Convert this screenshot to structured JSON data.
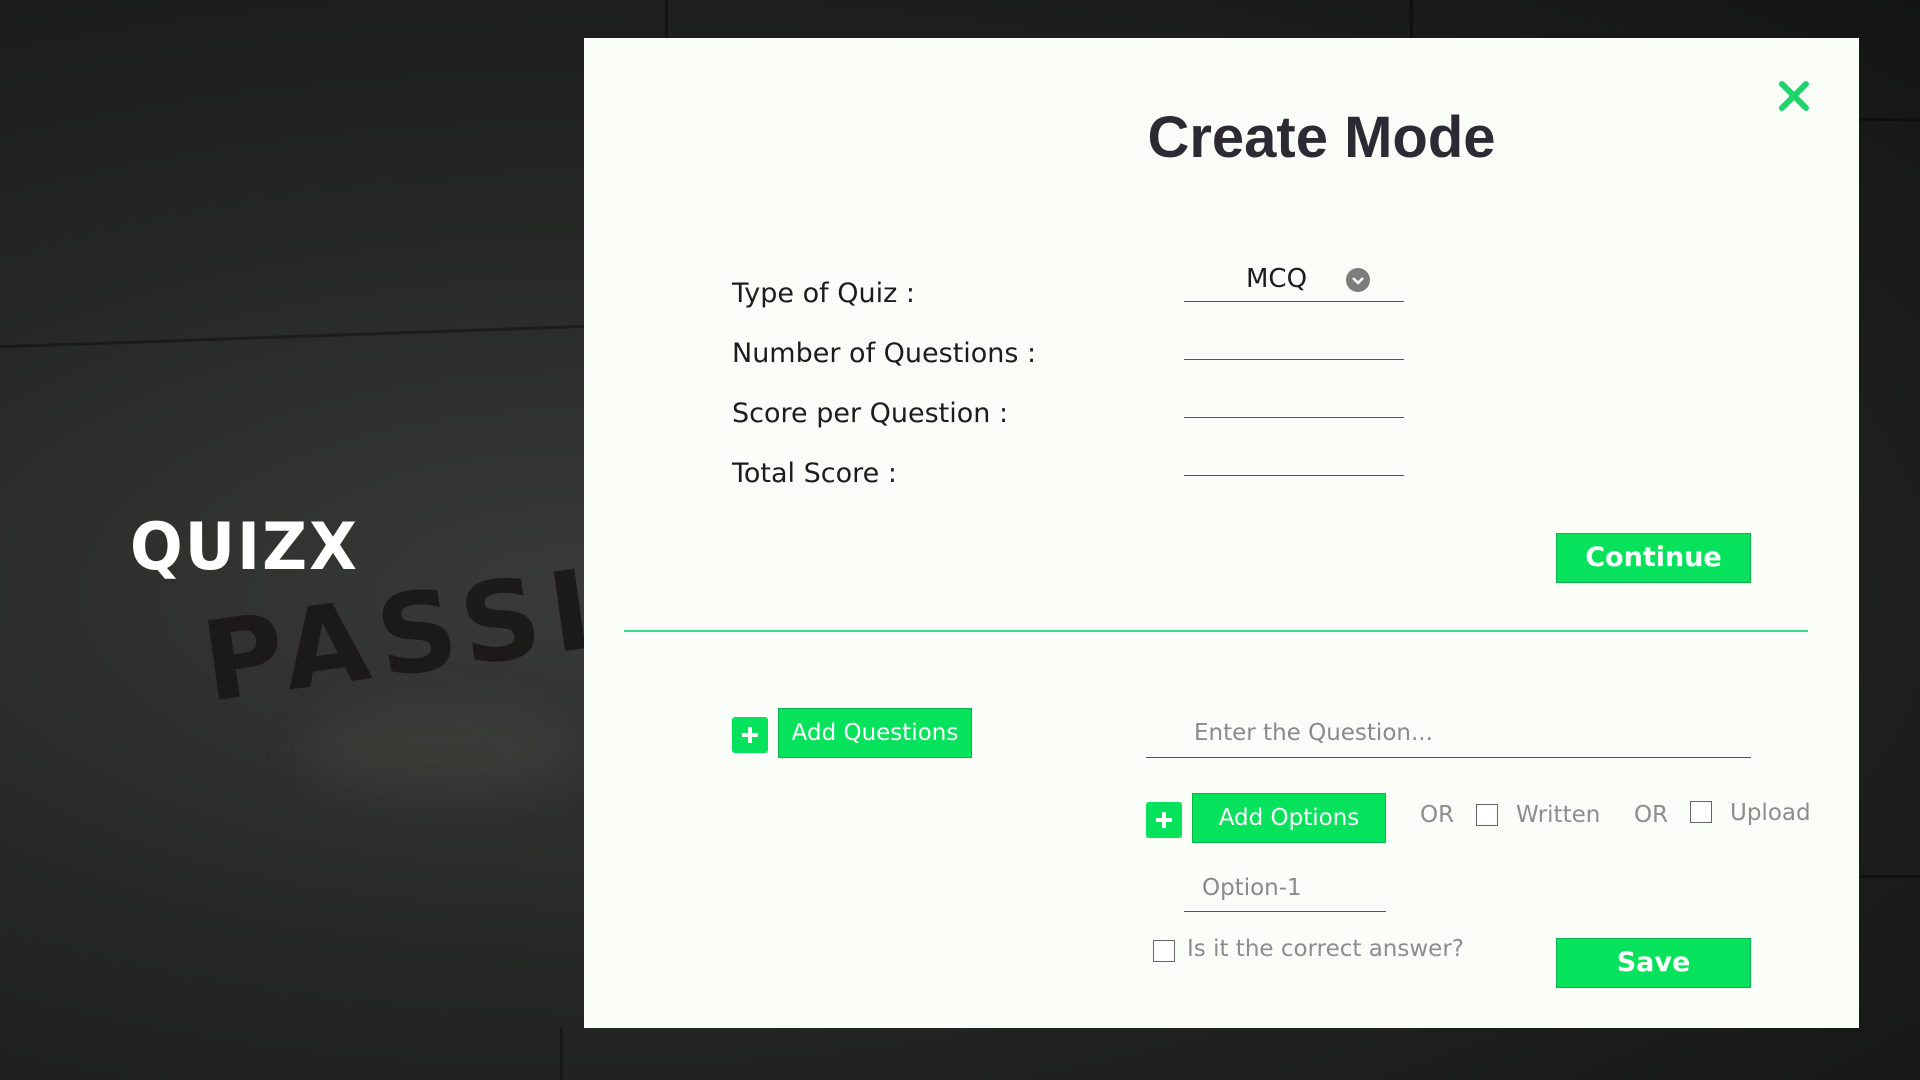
{
  "app": {
    "logo_text": "QUIZX",
    "background_word": "PASSIO"
  },
  "modal": {
    "title": "Create Mode",
    "close_icon": "close-x-icon",
    "fields": [
      {
        "label": "Type of Quiz :",
        "value": "MCQ"
      },
      {
        "label": "Number of Questions :",
        "value": ""
      },
      {
        "label": "Score per Question :",
        "value": ""
      },
      {
        "label": "Total Score :",
        "value": ""
      }
    ],
    "continue_label": "Continue",
    "questions": {
      "add_questions_label": "Add Questions",
      "question_placeholder": "Enter the Question...",
      "add_options_label": "Add Options",
      "or_1": "OR",
      "written_label": "Written",
      "or_2": "OR",
      "upload_label": "Upload",
      "option_placeholder": "Option-1",
      "correct_answer_label": "Is it the correct answer?",
      "save_label": "Save"
    }
  },
  "colors": {
    "accent": "#06e25b",
    "divider": "#35e082",
    "title": "#2e2a33",
    "close": "#1fd46a"
  }
}
